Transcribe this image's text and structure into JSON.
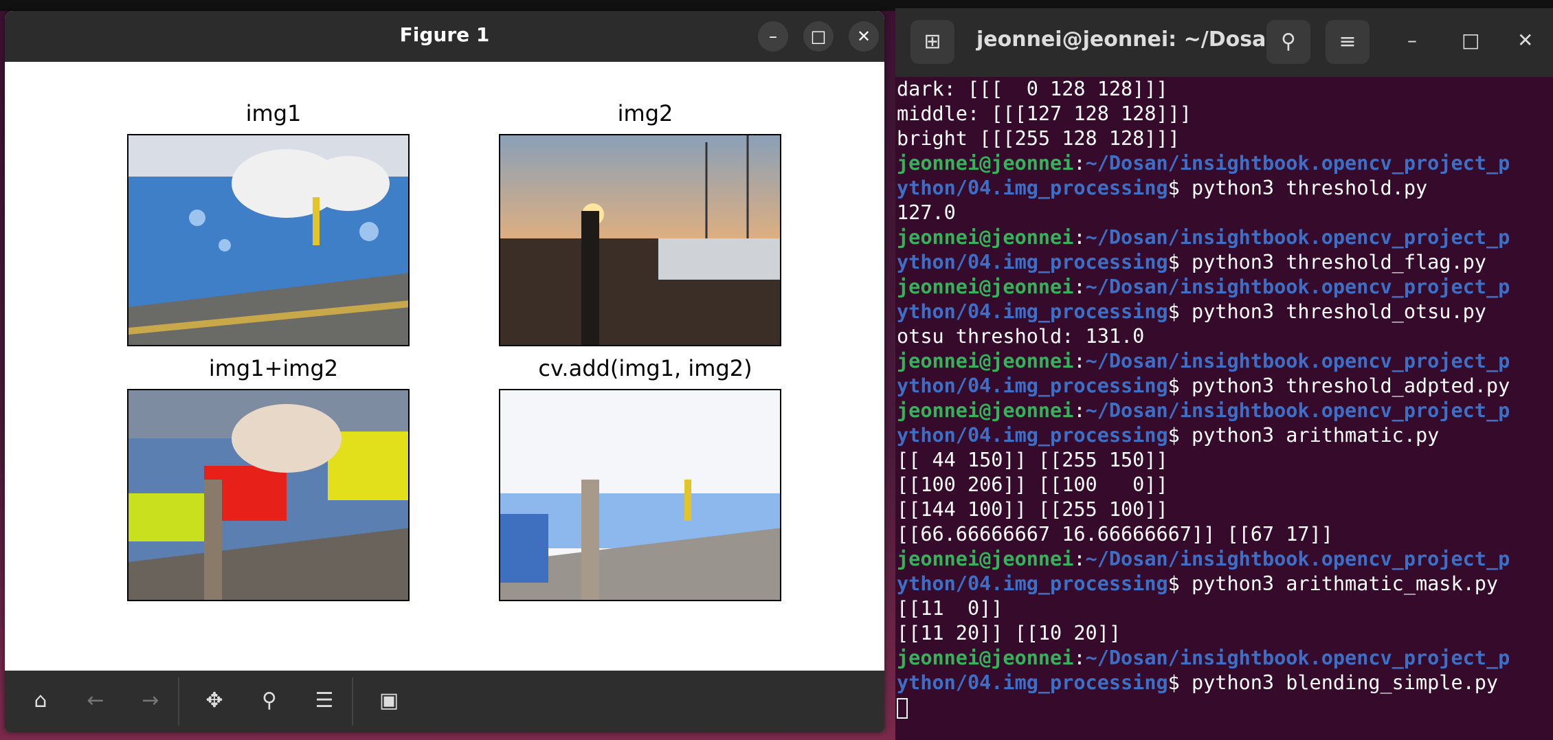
{
  "figure": {
    "title": "Figure 1",
    "window_controls": {
      "minimize": "–",
      "maximize": "□",
      "close": "✕"
    },
    "subplots": [
      {
        "title": "img1"
      },
      {
        "title": "img2"
      },
      {
        "title": "img1+img2"
      },
      {
        "title": "cv.add(img1, img2)"
      }
    ],
    "toolbar_icons": [
      "home-icon",
      "back-icon",
      "forward-icon",
      "pan-icon",
      "zoom-icon",
      "configure-icon",
      "save-icon"
    ]
  },
  "terminal": {
    "title": "jeonnei@jeonnei: ~/Dosa...",
    "window_controls": {
      "minimize": "–",
      "maximize": "□",
      "close": "✕"
    },
    "lines": [
      {
        "kind": "out",
        "text": "dark: [[[  0 128 128]]]"
      },
      {
        "kind": "out",
        "text": "middle: [[[127 128 128]]]"
      },
      {
        "kind": "out",
        "text": "bright [[[255 128 128]]]"
      },
      {
        "kind": "prompt1",
        "user": "jeonnei@jeonnei",
        "path": "~/Dosan/insightbook.opencv_project_p"
      },
      {
        "kind": "prompt2",
        "path": "ython/04.img_processing",
        "cmd": "$ python3 threshold.py"
      },
      {
        "kind": "out",
        "text": "127.0"
      },
      {
        "kind": "prompt1",
        "user": "jeonnei@jeonnei",
        "path": "~/Dosan/insightbook.opencv_project_p"
      },
      {
        "kind": "prompt2",
        "path": "ython/04.img_processing",
        "cmd": "$ python3 threshold_flag.py"
      },
      {
        "kind": "prompt1",
        "user": "jeonnei@jeonnei",
        "path": "~/Dosan/insightbook.opencv_project_p"
      },
      {
        "kind": "prompt2",
        "path": "ython/04.img_processing",
        "cmd": "$ python3 threshold_otsu.py"
      },
      {
        "kind": "out",
        "text": "otsu threshold: 131.0"
      },
      {
        "kind": "prompt1",
        "user": "jeonnei@jeonnei",
        "path": "~/Dosan/insightbook.opencv_project_p"
      },
      {
        "kind": "prompt2",
        "path": "ython/04.img_processing",
        "cmd": "$ python3 threshold_adpted.py"
      },
      {
        "kind": "prompt1",
        "user": "jeonnei@jeonnei",
        "path": "~/Dosan/insightbook.opencv_project_p"
      },
      {
        "kind": "prompt2",
        "path": "ython/04.img_processing",
        "cmd": "$ python3 arithmatic.py"
      },
      {
        "kind": "out",
        "text": "[[ 44 150]] [[255 150]]"
      },
      {
        "kind": "out",
        "text": "[[100 206]] [[100   0]]"
      },
      {
        "kind": "out",
        "text": "[[144 100]] [[255 100]]"
      },
      {
        "kind": "out",
        "text": "[[66.66666667 16.66666667]] [[67 17]]"
      },
      {
        "kind": "prompt1",
        "user": "jeonnei@jeonnei",
        "path": "~/Dosan/insightbook.opencv_project_p"
      },
      {
        "kind": "prompt2",
        "path": "ython/04.img_processing",
        "cmd": "$ python3 arithmatic_mask.py"
      },
      {
        "kind": "out",
        "text": "[[11  0]]"
      },
      {
        "kind": "out",
        "text": "[[11 20]] [[10 20]]"
      },
      {
        "kind": "prompt1",
        "user": "jeonnei@jeonnei",
        "path": "~/Dosan/insightbook.opencv_project_p"
      },
      {
        "kind": "prompt2",
        "path": "ython/04.img_processing",
        "cmd": "$ python3 blending_simple.py"
      }
    ]
  }
}
